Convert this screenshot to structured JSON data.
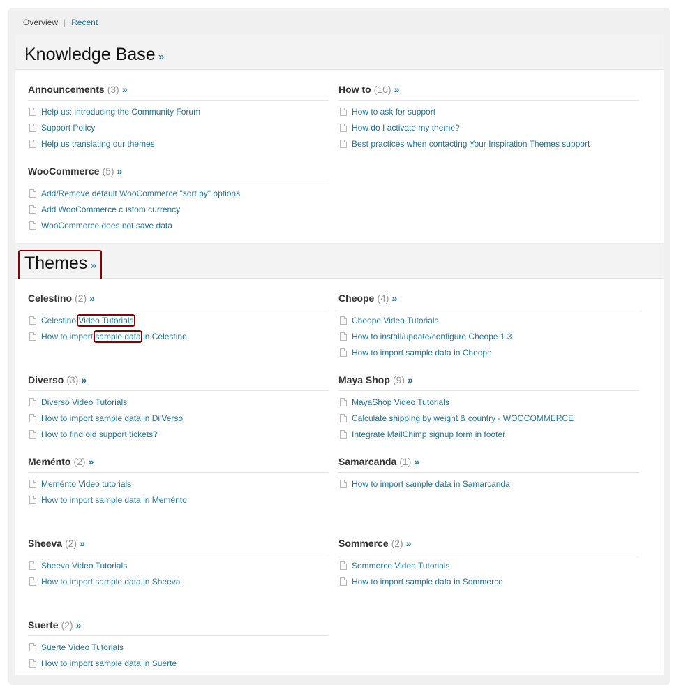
{
  "nav": {
    "overview": "Overview",
    "recent": "Recent"
  },
  "kb": {
    "title": "Knowledge Base",
    "raquo": "»",
    "categories": [
      {
        "name": "Announcements",
        "count": "(3)",
        "items": [
          "Help us: introducing the Community Forum",
          "Support Policy",
          "Help us translating our themes"
        ]
      },
      {
        "name": "How to",
        "count": "(10)",
        "items": [
          "How to ask for support",
          "How do I activate my theme?",
          "Best practices when contacting Your Inspiration Themes support"
        ]
      },
      {
        "name": "WooCommerce",
        "count": "(5)",
        "items": [
          "Add/Remove default WooCommerce \"sort by\" options",
          "Add WooCommerce custom currency",
          "WooCommerce does not save data"
        ]
      }
    ]
  },
  "themes": {
    "title": "Themes",
    "raquo": "»",
    "categories": [
      {
        "name": "Celestino",
        "count": "(2)",
        "items": [
          "Celestino Video Tutorials",
          "How to import sample data in Celestino"
        ]
      },
      {
        "name": "Cheope",
        "count": "(4)",
        "items": [
          "Cheope Video Tutorials",
          "How to install/update/configure Cheope 1.3",
          "How to import sample data in Cheope"
        ]
      },
      {
        "name": "Diverso",
        "count": "(3)",
        "items": [
          "Diverso Video Tutorials",
          "How to import sample data in Di'Verso",
          "How to find old support tickets?"
        ]
      },
      {
        "name": "Maya Shop",
        "count": "(9)",
        "items": [
          "MayaShop Video Tutorials",
          "Calculate shipping by weight & country - WOOCOMMERCE",
          "Integrate MailChimp signup form in footer"
        ]
      },
      {
        "name": "Meménto",
        "count": "(2)",
        "items": [
          "Meménto Video tutorials",
          "How to import sample data in Meménto"
        ]
      },
      {
        "name": "Samarcanda",
        "count": "(1)",
        "items": [
          "How to import sample data in Samarcanda"
        ]
      },
      {
        "name": "Sheeva",
        "count": "(2)",
        "items": [
          "Sheeva Video Tutorials",
          "How to import sample data in Sheeva"
        ]
      },
      {
        "name": "Sommerce",
        "count": "(2)",
        "items": [
          "Sommerce Video Tutorials",
          "How to import sample data in Sommerce"
        ]
      },
      {
        "name": "Suerte",
        "count": "(2)",
        "items": [
          "Suerte Video Tutorials",
          "How to import sample data in Suerte"
        ]
      }
    ],
    "celestino_highlights": {
      "item1_prefix": "Celestino ",
      "item1_hl": "Video Tutorials",
      "item2_prefix": "How to import ",
      "item2_hl": "sample data",
      "item2_suffix": " in Celestino"
    }
  },
  "colors": {
    "link": "#21759b",
    "highlight": "#8b0000"
  }
}
